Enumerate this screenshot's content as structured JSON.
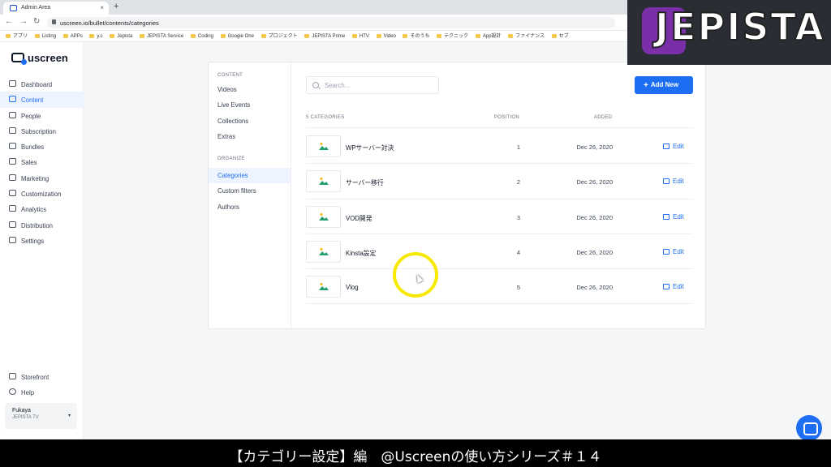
{
  "browser": {
    "tab_title": "Admin Area",
    "tab_close": "×",
    "new_tab": "+",
    "window_controls": [
      "—",
      "❐",
      "✕"
    ],
    "url": "uscreen.io/bullet/contents/categories",
    "bookmarks": [
      "アプリ",
      "Listing",
      "APPs",
      "y.c",
      "Jepista",
      "JEPISTA Service",
      "Coding",
      "Google One",
      "プロジェクト",
      "JEPISTA Prime",
      "HTV",
      "Video",
      "そのうち",
      "テクニック",
      "App設計",
      "ファイナンス",
      "セブ"
    ]
  },
  "sidebar": {
    "logo": "uscreen",
    "items": [
      {
        "label": "Dashboard",
        "icon": "grid-icon"
      },
      {
        "label": "Content",
        "icon": "folder-icon",
        "active": true
      },
      {
        "label": "People",
        "icon": "people-icon"
      },
      {
        "label": "Subscription",
        "icon": "refresh-icon"
      },
      {
        "label": "Bundles",
        "icon": "box-icon"
      },
      {
        "label": "Sales",
        "icon": "dollar-icon"
      },
      {
        "label": "Marketing",
        "icon": "megaphone-icon"
      },
      {
        "label": "Customization",
        "icon": "edit-icon"
      },
      {
        "label": "Analytics",
        "icon": "chart-icon"
      },
      {
        "label": "Distribution",
        "icon": "share-icon"
      },
      {
        "label": "Settings",
        "icon": "gear-icon"
      }
    ],
    "bottom_items": [
      {
        "label": "Storefront",
        "icon": "store-icon"
      },
      {
        "label": "Help",
        "icon": "help-icon"
      }
    ],
    "user": {
      "name": "Fukaya",
      "org": "JEPISTA TV"
    }
  },
  "subnav": {
    "content_heading": "CONTENT",
    "content_items": [
      "Videos",
      "Live Events",
      "Collections",
      "Extras"
    ],
    "organize_heading": "ORGANIZE",
    "organize_items": [
      "Categories",
      "Custom filters",
      "Authors"
    ],
    "active": "Categories"
  },
  "main": {
    "search_placeholder": "Search...",
    "add_button": "Add New",
    "table": {
      "count_header": "5 CATEGORIES",
      "position_header": "POSITION",
      "added_header": "ADDED",
      "edit_label": "Edit",
      "rows": [
        {
          "name": "WPサーバー対決",
          "position": "1",
          "added": "Dec 26, 2020"
        },
        {
          "name": "サーバー移行",
          "position": "2",
          "added": "Dec 26, 2020"
        },
        {
          "name": "VOD開発",
          "position": "3",
          "added": "Dec 26, 2020"
        },
        {
          "name": "Kinsta設定",
          "position": "4",
          "added": "Dec 26, 2020"
        },
        {
          "name": "Vlog",
          "position": "5",
          "added": "Dec 26, 2020"
        }
      ]
    }
  },
  "watermark": "JEPISTA",
  "caption": "【カテゴリー設定】編　@Uscreenの使い方シリーズ＃１４",
  "colors": {
    "accent": "#1d6ef2",
    "thumb_green": "#22a06b",
    "highlight": "#f7ea00"
  }
}
